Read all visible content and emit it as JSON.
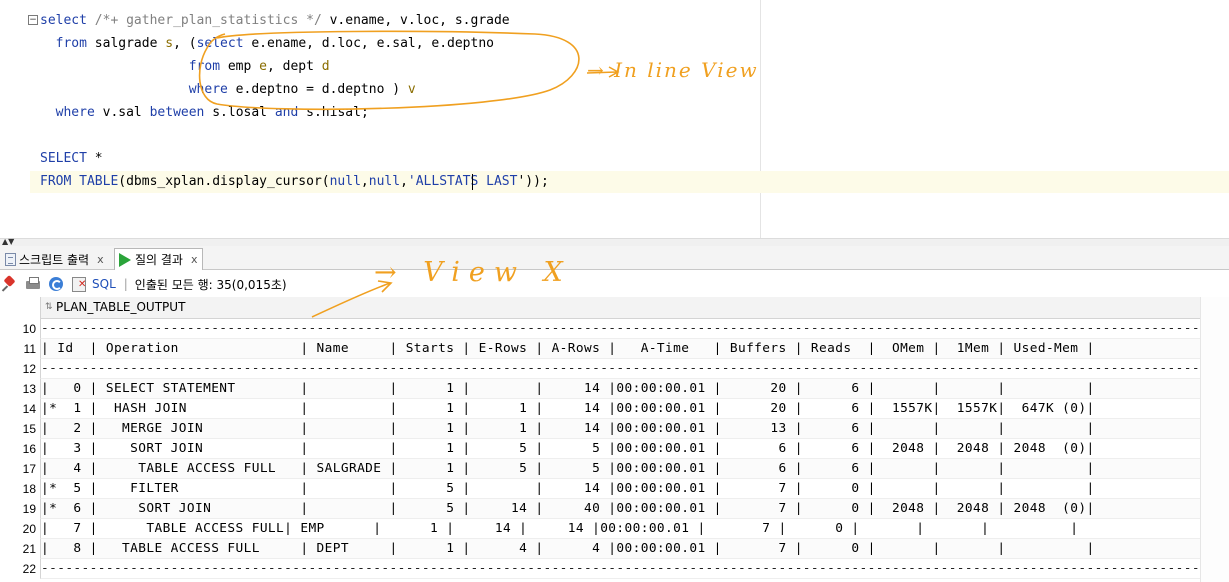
{
  "editor": {
    "sql_query_1": {
      "line1": {
        "kw_select": "select",
        "hint": "/*+ gather_plan_statistics */",
        "cols": " v.ename, v.loc, s.grade"
      },
      "line2": {
        "kw_from": "from",
        "table": " salgrade ",
        "alias": "s",
        "rest_a": ", (",
        "kw_select": "select",
        "rest_b": " e.ename, d.loc, e.sal, e.deptno"
      },
      "line3": {
        "kw_from": "from",
        "t1": " emp ",
        "a1": "e",
        "mid": ", dept ",
        "a2": "d"
      },
      "line4": {
        "kw_where": "where",
        "cond": " e.deptno = d.deptno ) ",
        "alias": "v"
      },
      "line5": {
        "kw_where": "where",
        "cond_a": " v.sal ",
        "kw_between": "between",
        "cond_b": " s.losal ",
        "kw_and": "and",
        "cond_c": " s.hisal;"
      }
    },
    "sql_query_2": {
      "line1": {
        "kw_select": "SELECT",
        "rest": " *"
      },
      "line2": {
        "kw_from": "FROM",
        "sp": " ",
        "kw_table": "TABLE",
        "call_a": "(dbms_xplan.display_cursor(",
        "null1": "null",
        "comma": ",",
        "null2": "null",
        "comma2": ",",
        "quote": "'",
        "arg": "ALLSTATS LAST",
        "close": "'));"
      }
    }
  },
  "annotations": {
    "inline_view_note": "→ In line View",
    "view_x_note": "→ View X"
  },
  "tabs": [
    {
      "label": "스크립트 출력",
      "close": "x",
      "active": false
    },
    {
      "label": "질의 결과",
      "close": "x",
      "active": true
    }
  ],
  "toolbar": {
    "sql_label": "SQL",
    "separator": "|",
    "fetched_text": "인출된 모든 행: 35(0,015초)"
  },
  "grid": {
    "column_header": "PLAN_TABLE_OUTPUT",
    "rows": [
      {
        "num": "10",
        "text": "----------------------------------------------------------------------------------------------------------------------------------------------------------------"
      },
      {
        "num": "11",
        "text": "| Id  | Operation               | Name     | Starts | E-Rows | A-Rows |   A-Time   | Buffers | Reads  |  OMem |  1Mem | Used-Mem |"
      },
      {
        "num": "12",
        "text": "----------------------------------------------------------------------------------------------------------------------------------------------------------------"
      },
      {
        "num": "13",
        "text": "|   0 | SELECT STATEMENT        |          |      1 |        |     14 |00:00:00.01 |      20 |      6 |       |       |          |"
      },
      {
        "num": "14",
        "text": "|*  1 |  HASH JOIN              |          |      1 |      1 |     14 |00:00:00.01 |      20 |      6 |  1557K|  1557K|  647K (0)|"
      },
      {
        "num": "15",
        "text": "|   2 |   MERGE JOIN            |          |      1 |      1 |     14 |00:00:00.01 |      13 |      6 |       |       |          |"
      },
      {
        "num": "16",
        "text": "|   3 |    SORT JOIN            |          |      1 |      5 |      5 |00:00:00.01 |       6 |      6 |  2048 |  2048 | 2048  (0)|"
      },
      {
        "num": "17",
        "text": "|   4 |     TABLE ACCESS FULL   | SALGRADE |      1 |      5 |      5 |00:00:00.01 |       6 |      6 |       |       |          |"
      },
      {
        "num": "18",
        "text": "|*  5 |    FILTER               |          |      5 |        |     14 |00:00:00.01 |       7 |      0 |       |       |          |"
      },
      {
        "num": "19",
        "text": "|*  6 |     SORT JOIN           |          |      5 |     14 |     40 |00:00:00.01 |       7 |      0 |  2048 |  2048 | 2048  (0)|"
      },
      {
        "num": "20",
        "text": "|   7 |      TABLE ACCESS FULL| EMP      |      1 |     14 |     14 |00:00:00.01 |       7 |      0 |       |       |          |"
      },
      {
        "num": "21",
        "text": "|   8 |   TABLE ACCESS FULL     | DEPT     |      1 |      4 |      4 |00:00:00.01 |       7 |      0 |       |       |          |"
      },
      {
        "num": "22",
        "text": "----------------------------------------------------------------------------------------------------------------------------------------------------------------"
      }
    ]
  },
  "colors": {
    "keyword": "#1f3fa8",
    "comment": "#808080",
    "alias": "#8a6d00",
    "annotation": "#f0a020",
    "current_line": "#fdfbe8"
  }
}
